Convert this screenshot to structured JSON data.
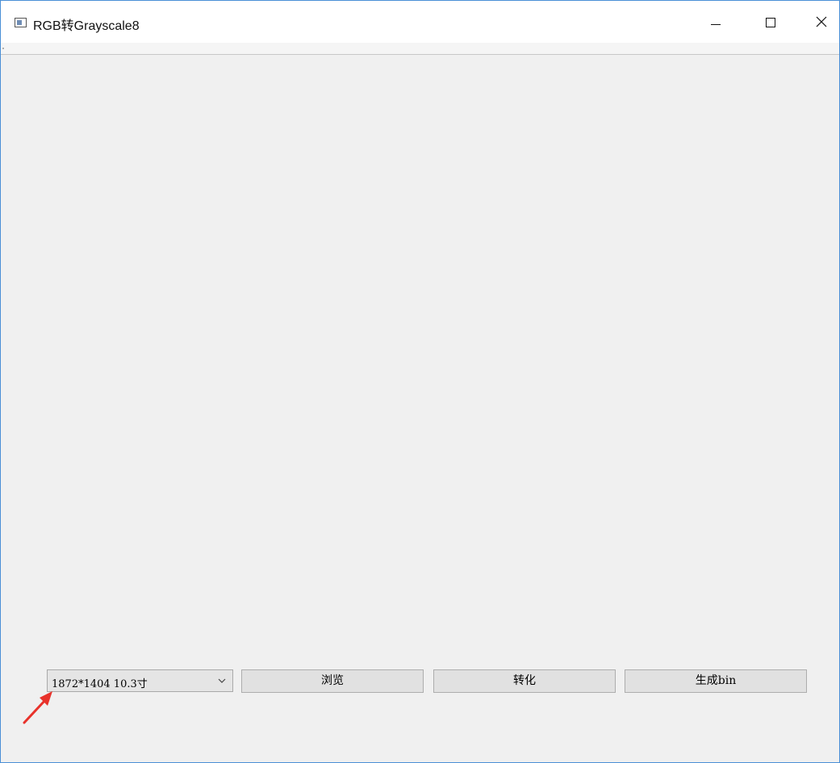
{
  "window": {
    "title": "RGB转Grayscale8",
    "icons": {
      "app": "app-window-icon",
      "minimize": "minimize-icon",
      "maximize": "maximize-icon",
      "close": "close-icon"
    }
  },
  "controls": {
    "resolution_select": {
      "selected": "1872*1404 10.3寸",
      "icon": "chevron-down-icon"
    },
    "browse_label": "浏览",
    "convert_label": "转化",
    "generate_bin_label": "生成bin"
  },
  "annotation": {
    "arrow_color": "#e8322b"
  },
  "colors": {
    "window_border": "#4a8fd6",
    "client_background": "#f0f0f0",
    "button_face": "#e1e1e1"
  }
}
